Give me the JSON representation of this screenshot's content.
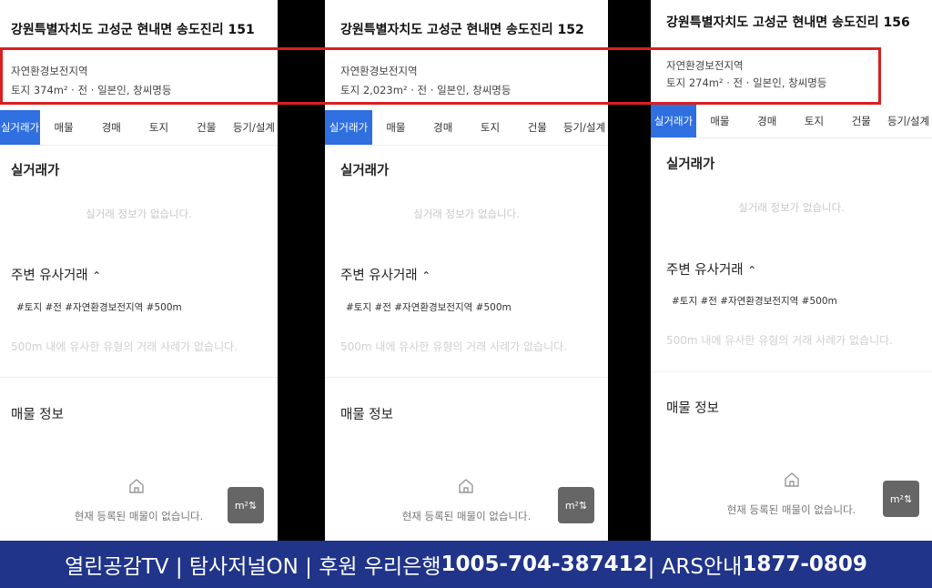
{
  "panels": [
    {
      "address": "강원특별자치도 고성군 현내면 송도진리 151",
      "zoning": "자연환경보전지역",
      "land_info": "토지 374m² · 전 · 일본인, 창씨명등",
      "tabs": [
        "실거래가",
        "매물",
        "경매",
        "토지",
        "건물",
        "등기/설계"
      ],
      "active_tab": "실거래가",
      "real_price_title": "실거래가",
      "real_price_empty": "실거래 정보가 없습니다.",
      "nearby_title": "주변 유사거래",
      "nearby_tags": "#토지 #전 #자연환경보전지역 #500m",
      "nearby_empty": "500m 내에 유사한 유형의 거래 사례가 없습니다.",
      "listing_title": "매물 정보",
      "listing_empty": "현재 등록된 매물이 없습니다.",
      "unit_button": "m²⇅"
    },
    {
      "address": "강원특별자치도 고성군 현내면 송도진리 152",
      "zoning": "자연환경보전지역",
      "land_info": "토지 2,023m² · 전 · 일본인, 창씨명등",
      "tabs": [
        "실거래가",
        "매물",
        "경매",
        "토지",
        "건물",
        "등기/설계"
      ],
      "active_tab": "실거래가",
      "real_price_title": "실거래가",
      "real_price_empty": "실거래 정보가 없습니다.",
      "nearby_title": "주변 유사거래",
      "nearby_tags": "#토지 #전 #자연환경보전지역 #500m",
      "nearby_empty": "500m 내에 유사한 유형의 거래 사례가 없습니다.",
      "listing_title": "매물 정보",
      "listing_empty": "현재 등록된 매물이 없습니다.",
      "unit_button": "m²⇅"
    },
    {
      "address": "강원특별자치도 고성군 현내면 송도진리 156",
      "zoning": "자연환경보전지역",
      "land_info": "토지 274m² · 전 · 일본인, 창씨명등",
      "tabs": [
        "실거래가",
        "매물",
        "경매",
        "토지",
        "건물",
        "등기/설계"
      ],
      "active_tab": "실거래가",
      "real_price_title": "실거래가",
      "real_price_empty": "실거래 정보가 없습니다.",
      "nearby_title": "주변 유사거래",
      "nearby_tags": "#토지 #전 #자연환경보전지역 #500m",
      "nearby_empty": "500m 내에 유사한 유형의 거래 사례가 없습니다.",
      "listing_title": "매물 정보",
      "listing_empty": "현재 등록된 매물이 없습니다.",
      "unit_button": "m²⇅"
    }
  ],
  "banner": {
    "text_1": "열린공감TV | 탐사저널ON | 후원 우리은행 ",
    "account": "1005-704-387412",
    "text_2": " | ARS안내 ",
    "ars": "1877-0809"
  },
  "colors": {
    "accent_tab": "#2f6fe0",
    "highlight_border": "#d82020",
    "banner_bg": "#20348a"
  }
}
